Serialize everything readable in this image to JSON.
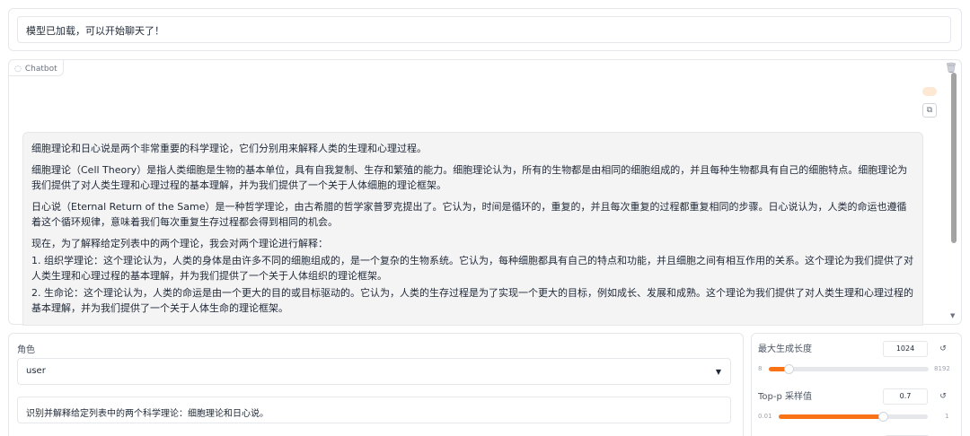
{
  "status": {
    "message": "模型已加载，可以开始聊天了！"
  },
  "chatbot": {
    "label": "Chatbot",
    "icons": {
      "label_icon": "chat-bubble-icon",
      "clear_icon": "trash-icon",
      "copy_icon": "copy-icon"
    },
    "colors": {
      "user_bubble": "#fde8d3",
      "bot_bubble": "#f4f4f5"
    },
    "bot_message": {
      "p1": "细胞理论和日心说是两个非常重要的科学理论，它们分别用来解释人类的生理和心理过程。",
      "p2": "细胞理论（Cell Theory）是指人类细胞是生物的基本单位，具有自我复制、生存和繁殖的能力。细胞理论认为，所有的生物都是由相同的细胞组成的，并且每种生物都具有自己的细胞特点。细胞理论为我们提供了对人类生理和心理过程的基本理解，并为我们提供了一个关于人体细胞的理论框架。",
      "p3": "日心说（Eternal Return of the Same）是一种哲学理论，由古希腊的哲学家普罗克提出了。它认为，时间是循环的，重复的，并且每次重复的过程都重复相同的步骤。日心说认为，人类的命运也遵循着这个循环规律，意味着我们每次重复生存过程都会得到相同的机会。",
      "p4": "现在，为了解释给定列表中的两个理论，我会对两个理论进行解释：",
      "p5": "1. 组织学理论：这个理论认为，人类的身体是由许多不同的细胞组成的，是一个复杂的生物系统。它认为，每种细胞都具有自己的特点和功能，并且细胞之间有相互作用的关系。这个理论为我们提供了对人类生理和心理过程的基本理解，并为我们提供了一个关于人体组织的理论框架。",
      "p6": "2. 生命论：这个理论认为，人类的命运是由一个更大的目的或目标驱动的。它认为，人类的生存过程是为了实现一个更大的目标，例如成长、发展和成熟。这个理论为我们提供了对人类生理和心理过程的基本理解，并为我们提供了一个关于人体生命的理论框架。"
    }
  },
  "role": {
    "label": "角色",
    "selected": "user",
    "caret_icon": "caret-down-icon"
  },
  "prompt": {
    "value": "识别并解释给定列表中的两个科学理论：细胞理论和日心说。"
  },
  "params": {
    "accent_color": "#f97316",
    "max_length": {
      "label": "最大生成长度",
      "value": "1024",
      "min": "8",
      "max": "8192",
      "fraction": 0.124,
      "reset_icon": "reset-icon"
    },
    "top_p": {
      "label": "Top-p 采样值",
      "value": "0.7",
      "min": "0.01",
      "max": "1",
      "fraction": 0.697,
      "reset_icon": "reset-icon"
    }
  }
}
